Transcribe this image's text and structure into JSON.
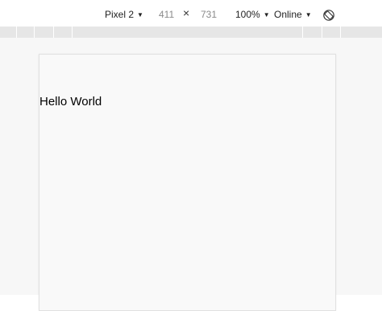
{
  "toolbar": {
    "device": "Pixel 2",
    "width": "411",
    "times_symbol": "×",
    "height": "731",
    "zoom": "100%",
    "throttling": "Online",
    "caret": "▼"
  },
  "page": {
    "text": "Hello World"
  },
  "colors": {
    "ruler": "#e6e6e6",
    "canvas": "#f7f7f7",
    "viewport": "#f9f9f9"
  },
  "icons": {
    "rotate": "rotate-icon"
  }
}
